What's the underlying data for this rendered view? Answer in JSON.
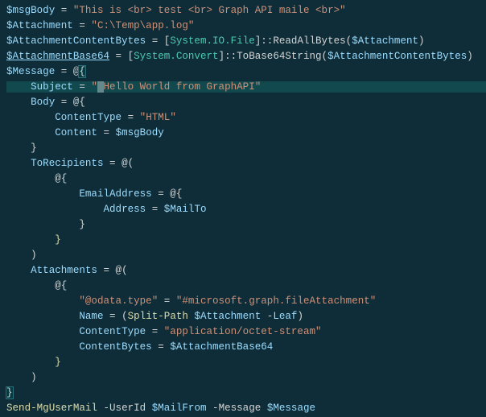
{
  "l1": {
    "v": "$msgBody",
    "eq": " = ",
    "s": "\"This is <br> test <br> Graph API maile <br>\""
  },
  "l2": {
    "v": "$Attachment",
    "eq": " = ",
    "s": "\"C:\\Temp\\app.log\""
  },
  "l3": {
    "v": "$AttachmentContentBytes",
    "eq": " = ",
    "lb": "[",
    "t1": "System.IO.File",
    "rb": "]",
    "m": "::ReadAllBytes(",
    "v2": "$Attachment",
    "cp": ")"
  },
  "l4": {
    "v": "$AttachmentBase64",
    "eq": " = ",
    "lb": "[",
    "t1": "System.Convert",
    "rb": "]",
    "m": "::ToBase64String(",
    "v2": "$AttachmentContentBytes",
    "cp": ")"
  },
  "l5": {
    "v": "$Message",
    "eq": " = @",
    "ob": "{"
  },
  "l6": {
    "pad": "    ",
    "k": "Subject",
    "eq": " = ",
    "q": "\"",
    "s": "Hello World from GraphAPI\""
  },
  "l7": {
    "pad": "    ",
    "k": "Body",
    "eq": " = @{"
  },
  "l8": {
    "pad": "        ",
    "k": "ContentType",
    "eq": " = ",
    "s": "\"HTML\""
  },
  "l9": {
    "pad": "        ",
    "k": "Content",
    "eq": " = ",
    "v2": "$msgBody"
  },
  "l10": {
    "pad": "    ",
    "cb": "}"
  },
  "l11": {
    "pad": "    ",
    "k": "ToRecipients",
    "eq": " = @("
  },
  "l12": {
    "pad": "        ",
    "t": "@{"
  },
  "l13": {
    "pad": "            ",
    "k": "EmailAddress",
    "eq": " = @{"
  },
  "l14": {
    "pad": "                ",
    "k": "Address",
    "eq": " = ",
    "v2": "$MailTo"
  },
  "l15": {
    "pad": "            ",
    "t": "}"
  },
  "l16": {
    "pad": "        ",
    "t": "}"
  },
  "l17": {
    "pad": "    ",
    "t": ")"
  },
  "l18": {
    "pad": "    ",
    "k": "Attachments",
    "eq": " = @("
  },
  "l19": {
    "pad": "        ",
    "t": "@{"
  },
  "l20": {
    "pad": "            ",
    "s1": "\"@odata.type\"",
    "eq": " = ",
    "s2": "\"#microsoft.graph.fileAttachment\""
  },
  "l21": {
    "pad": "            ",
    "k": "Name",
    "eq": " = (",
    "cmd": "Split-Path",
    "sp": " ",
    "v2": "$Attachment",
    "sp2": " -",
    "pk": "Leaf",
    "cp": ")"
  },
  "l22": {
    "pad": "            ",
    "k": "ContentType",
    "eq": " = ",
    "s": "\"application/octet-stream\""
  },
  "l23": {
    "pad": "            ",
    "k": "ContentBytes",
    "eq": " = ",
    "v2": "$AttachmentBase64"
  },
  "l24": {
    "pad": "        ",
    "t": "}"
  },
  "l25": {
    "pad": "    ",
    "t": ")"
  },
  "l26": {
    "t": "}"
  },
  "l27": {
    "cmd": "Send-MgUserMail",
    "sp": " -",
    "p1": "UserId",
    "sp2": " ",
    "v1": "$MailFrom",
    "sp3": " -",
    "p2": "Message",
    "sp4": " ",
    "v2": "$Message"
  }
}
